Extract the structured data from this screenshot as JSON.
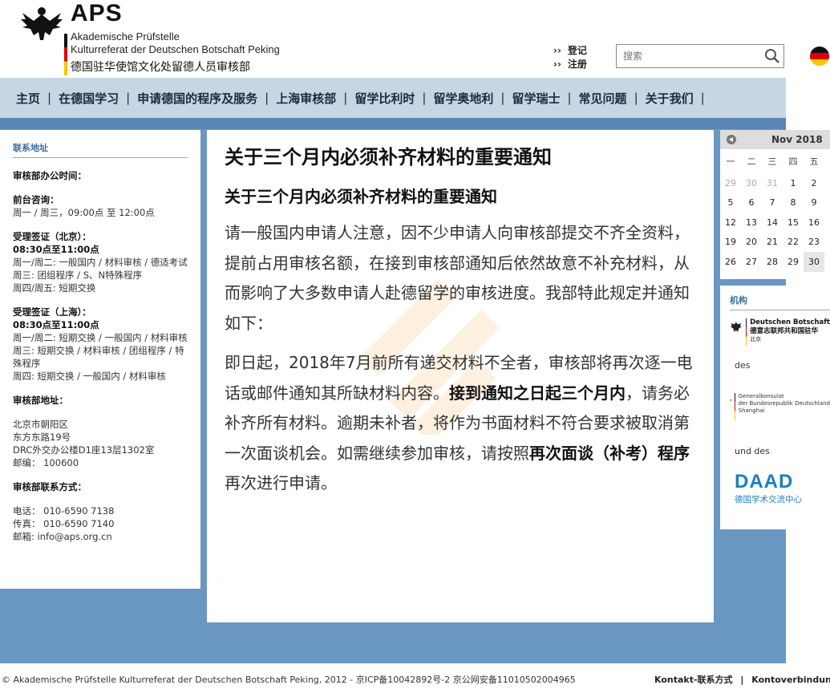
{
  "header": {
    "aps": "APS",
    "line1": "Akademische Prüfstelle",
    "line2": "Kulturreferat der Deutschen Botschaft Peking",
    "line3": "德国驻华使馆文化处留德人员审核部",
    "login": "登记",
    "register": "注册",
    "search_placeholder": "搜索"
  },
  "nav": [
    "主页",
    "在德国学习",
    "申请德国的程序及服务",
    "上海审核部",
    "留学比利时",
    "留学奥地利",
    "留学瑞士",
    "常见问题",
    "关于我们"
  ],
  "sidebar": {
    "title": "联系地址",
    "office_hours": "审核部办公时间：",
    "front_desk_label": "前台咨询：",
    "front_desk_time": "周一 / 周三，09:00点 至 12:00点",
    "beijing_label": "受理签证（北京）：",
    "beijing_time": "08:30点至11:00点",
    "beijing_lines": [
      "周一/周二: 一般国内 / 材料审核 / 德适考试",
      "周三: 团组程序 / S、N特殊程序",
      "周四/周五: 短期交换"
    ],
    "shanghai_label": "受理签证（上海）：",
    "shanghai_time": "08:30点至11:00点",
    "shanghai_lines": [
      "周一/周二: 短期交换 / 一般国内 / 材料审核",
      "周三: 短期交换 / 材料审核 / 团组程序 / 特殊程序",
      "周四: 短期交换 / 一般国内 / 材料审核"
    ],
    "address_label": "审核部地址：",
    "address_lines": [
      "北京市朝阳区",
      "东方东路19号",
      "DRC外交办公楼D1座13层1302室",
      "邮编： 100600"
    ],
    "contact_label": "审核部联系方式：",
    "contact_lines": [
      "电话： 010-6590 7138",
      "传真： 010-6590 7140",
      "邮箱: info@aps.org.cn"
    ]
  },
  "main": {
    "title": "关于三个月内必须补齐材料的重要通知",
    "subtitle": "关于三个月内必须补齐材料的重要通知",
    "p1": "请一般国内申请人注意，因不少申请人向审核部提交不齐全资料，提前占用审核名额，在接到审核部通知后依然故意不补充材料，从而影响了大多数申请人赴德留学的审核进度。我部特此规定并通知如下：",
    "p2_a": "即日起，2018年7月前所有递交材料不全者，审核部将再次逐一电话或邮件通知其所缺材料内容。",
    "p2_b": "接到通知之日起三个月内",
    "p2_c": "，请务必补齐所有材料。逾期未补者，将作为书面材料不符合要求被取消第一次面谈机会。如需继续参加审核，请按照",
    "p2_d": "再次面谈（补考）程序",
    "p2_e": "再次进行申请。"
  },
  "calendar": {
    "title": "Nov 2018",
    "weekdays": [
      "一",
      "二",
      "三",
      "四",
      "五"
    ],
    "rows": [
      [
        "29",
        "30",
        "31",
        "1",
        "2"
      ],
      [
        "5",
        "6",
        "7",
        "8",
        "9"
      ],
      [
        "12",
        "13",
        "14",
        "15",
        "16"
      ],
      [
        "19",
        "20",
        "21",
        "22",
        "23"
      ],
      [
        "26",
        "27",
        "28",
        "29",
        "30"
      ]
    ]
  },
  "partners": {
    "title": "机构",
    "embassy_line1": "Deutschen Botschaft",
    "embassy_line2": "德意志联邦共和国驻华",
    "embassy_line3": "北京",
    "des1": "des",
    "consulate_line1": "Generalkonsulat",
    "consulate_line2": "der Bundesrepublik Deutschland",
    "consulate_line3": "Shanghai",
    "und_des": "und des",
    "daad": "DAAD",
    "daad_sub": "德国学术交流中心"
  },
  "footer": {
    "copyright": "© Akademische Prüfstelle Kulturreferat der Deutschen Botschaft Peking, 2012 - 京ICP备10042892号-2   京公网安备11010502004965",
    "contact": "Kontakt-联系方式",
    "sep": "|",
    "account": "Kontoverbindung-汇"
  }
}
